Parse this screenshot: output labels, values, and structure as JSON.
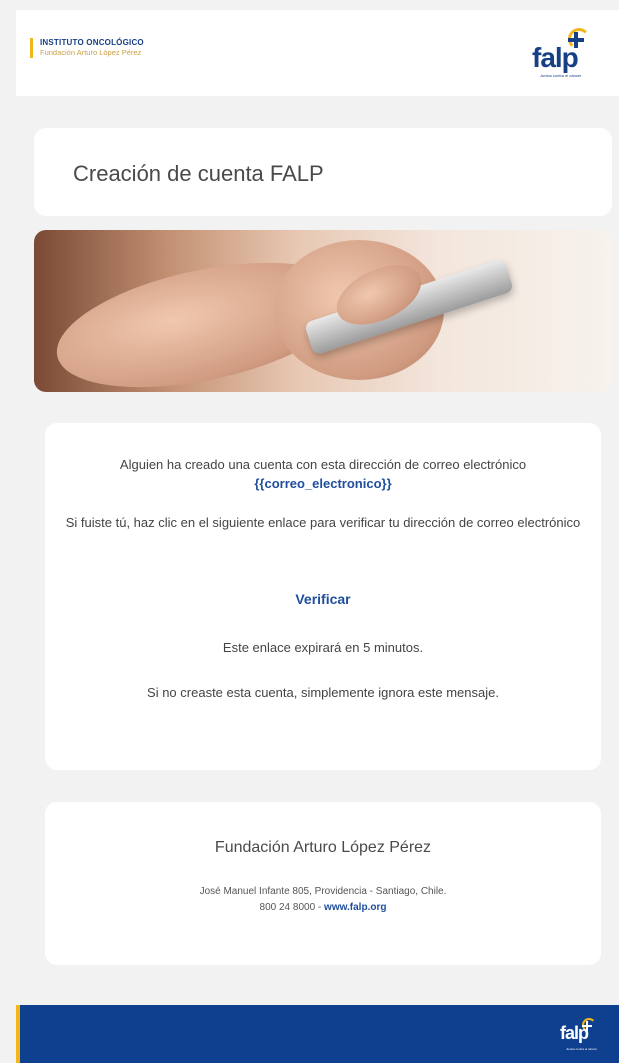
{
  "header": {
    "institution_title": "INSTITUTO ONCOLÓGICO",
    "institution_subtitle": "Fundación Arturo López Pérez",
    "logo_text": "falp",
    "logo_tagline": "Juntos contra el cáncer"
  },
  "title_card": {
    "title": "Creación de cuenta FALP"
  },
  "hero_image": {
    "description_icon": "hands-holding-phone-image"
  },
  "message": {
    "line1": "Alguien ha creado una cuenta con esta dirección de correo electrónico",
    "email_placeholder": "{{correo_electronico}}",
    "line2": "Si fuiste tú, haz clic en el siguiente enlace para verificar tu dirección de correo electrónico",
    "verify_link": "Verificar",
    "expiry": "Este enlace expirará en 5 minutos.",
    "ignore": "Si no creaste esta cuenta, simplemente ignora este mensaje."
  },
  "footer": {
    "org_name": "Fundación Arturo López Pérez",
    "address": "José Manuel Infante 805, Providencia - Santiago, Chile.",
    "phone": "800 24 8000",
    "separator": " - ",
    "website": "www.falp.org"
  },
  "bottom_bar": {
    "logo_text": "falp",
    "logo_tagline": "Juntos contra el cáncer"
  },
  "colors": {
    "brand_blue": "#173f86",
    "accent_yellow": "#f2b51b",
    "link_blue": "#1f4e9c",
    "footer_bar": "#0f3f8f"
  }
}
